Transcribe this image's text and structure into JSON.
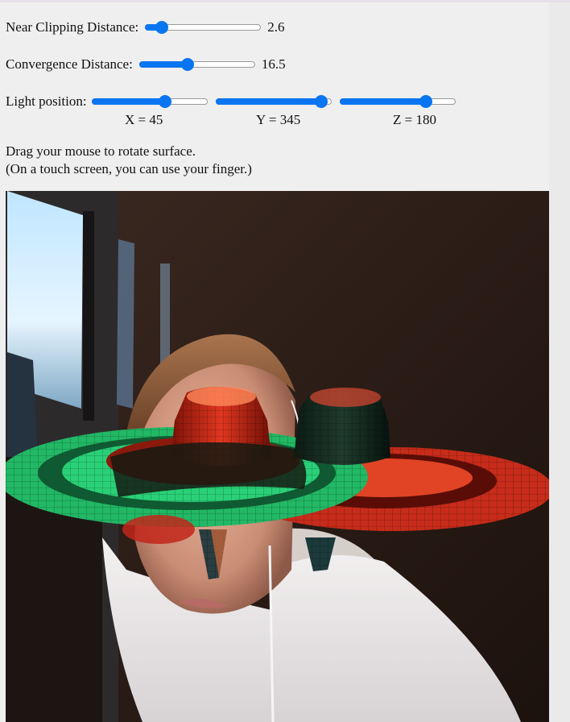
{
  "controls": {
    "near_clipping": {
      "label": "Near Clipping Distance:",
      "value": "2.6",
      "fraction": 0.1
    },
    "convergence": {
      "label": "Convergence Distance:",
      "value": "16.5",
      "fraction": 0.41
    },
    "light": {
      "label": "Light position:",
      "x": {
        "text": "X = 45",
        "fraction": 0.65
      },
      "y": {
        "text": "Y = 345",
        "fraction": 0.96
      },
      "z": {
        "text": "Z = 180",
        "fraction": 0.77
      }
    }
  },
  "instructions": {
    "line1": "Drag your mouse to rotate surface.",
    "line2": "(On a touch screen, you can use your finger.)"
  },
  "colors": {
    "slider_accent": "#0a75f0",
    "surface_red": "#d4301c",
    "surface_green": "#25c26a"
  },
  "icons": {
    "webcam_feed": "webcam-background-with-3d-surface-overlay"
  }
}
